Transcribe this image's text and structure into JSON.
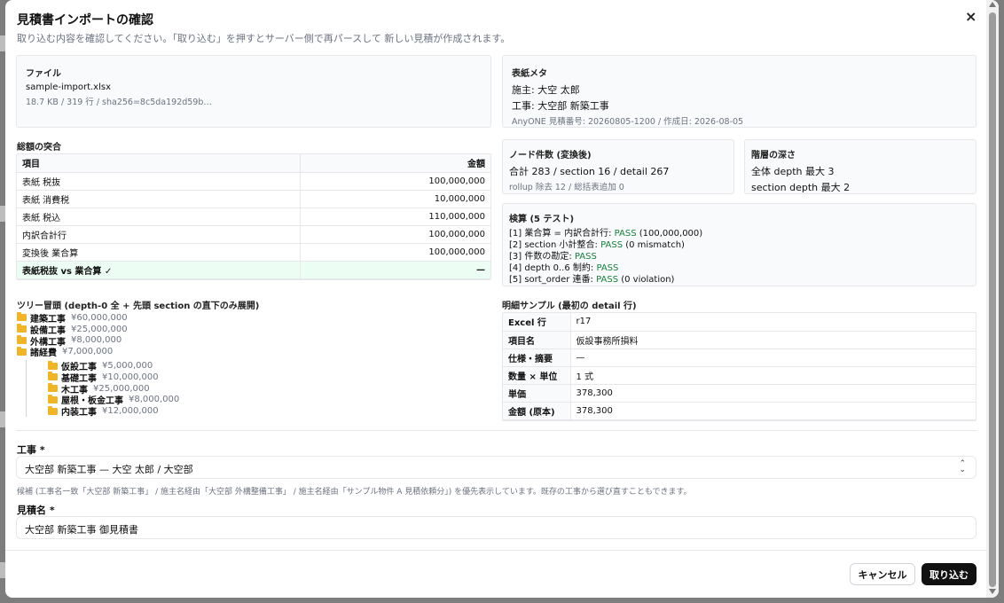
{
  "dialog": {
    "title": "見積書インポートの確認",
    "subtitle": "取り込む内容を確認してください。「取り込む」を押すとサーバー側で再パースして 新しい見積が作成されます。",
    "close_icon": "×"
  },
  "file_card": {
    "heading": "ファイル",
    "filename": "sample-import.xlsx",
    "meta": "18.7 KB / 319 行 / sha256=8c5da192d59b…"
  },
  "cover_meta": {
    "heading": "表紙メタ",
    "client": "施主: 大空 太郎",
    "project": "工事: 大空部 新築工事",
    "meta": "AnyONE 見積番号: 20260805-1200 / 作成日: 2026-08-05"
  },
  "totals": {
    "heading": "総額の突合",
    "col_item": "項目",
    "col_amount": "金額",
    "rows": [
      {
        "item": "表紙 税抜",
        "amount": "100,000,000"
      },
      {
        "item": "表紙 消費税",
        "amount": "10,000,000"
      },
      {
        "item": "表紙 税込",
        "amount": "110,000,000"
      },
      {
        "item": "内訳合計行",
        "amount": "100,000,000"
      },
      {
        "item": "変換後 業合算",
        "amount": "100,000,000"
      }
    ],
    "check_row": {
      "item": "表紙税抜 vs 業合算 ✓",
      "amount": "—"
    }
  },
  "node_count": {
    "heading": "ノード件数 (変換後)",
    "value": "合計 283 / section 16 / detail 267",
    "sub": "rollup 除去 12 / 総括表追加 0"
  },
  "depth": {
    "heading": "階層の深さ",
    "line1": "全体 depth 最大 3",
    "line2": "section depth 最大 2"
  },
  "verify": {
    "heading": "検算 (5 テスト)",
    "tests": [
      {
        "label": "[1] 業合算 = 内訳合計行:",
        "result": "PASS",
        "extra": "(100,000,000)"
      },
      {
        "label": "[2] section 小計整合:",
        "result": "PASS",
        "extra": "(0 mismatch)"
      },
      {
        "label": "[3] 件数の勘定:",
        "result": "PASS",
        "extra": ""
      },
      {
        "label": "[4] depth 0..6 制約:",
        "result": "PASS",
        "extra": ""
      },
      {
        "label": "[5] sort_order 連番:",
        "result": "PASS",
        "extra": "(0 violation)"
      }
    ]
  },
  "tree": {
    "heading": "ツリー冒頭 (depth-0 全 + 先頭 section の直下のみ展開)",
    "top": [
      {
        "name": "建築工事",
        "amount": "¥60,000,000"
      },
      {
        "name": "設備工事",
        "amount": "¥25,000,000"
      },
      {
        "name": "外構工事",
        "amount": "¥8,000,000"
      },
      {
        "name": "諸経費",
        "amount": "¥7,000,000"
      }
    ],
    "children": [
      {
        "name": "仮設工事",
        "amount": "¥5,000,000"
      },
      {
        "name": "基礎工事",
        "amount": "¥10,000,000"
      },
      {
        "name": "木工事",
        "amount": "¥25,000,000"
      },
      {
        "name": "屋根・板金工事",
        "amount": "¥8,000,000"
      },
      {
        "name": "内装工事",
        "amount": "¥12,000,000"
      }
    ]
  },
  "sample": {
    "heading": "明細サンプル (最初の detail 行)",
    "rows": [
      {
        "key": "Excel 行",
        "value": "r17"
      },
      {
        "key": "項目名",
        "value": "仮設事務所損料"
      },
      {
        "key": "仕様・摘要",
        "value": "—"
      },
      {
        "key": "数量 × 単位",
        "value": "1 式"
      },
      {
        "key": "単価",
        "value": "378,300"
      },
      {
        "key": "金額 (原本)",
        "value": "378,300"
      }
    ]
  },
  "form": {
    "project_label": "工事 *",
    "project_value": "大空部 新築工事 — 大空 太郎 / 大空部",
    "project_hint": "候補 (工事名一致「大空部 新築工事」 / 施主名経由「大空部 外構整備工事」 / 施主名経由「サンプル物件 A 見積依頼分」) を優先表示しています。既存の工事から選び直すこともできます。",
    "estimate_label": "見積名 *",
    "estimate_value": "大空部 新築工事 御見積書"
  },
  "footer": {
    "cancel_label": "キャンセル",
    "import_label": "取り込む"
  }
}
